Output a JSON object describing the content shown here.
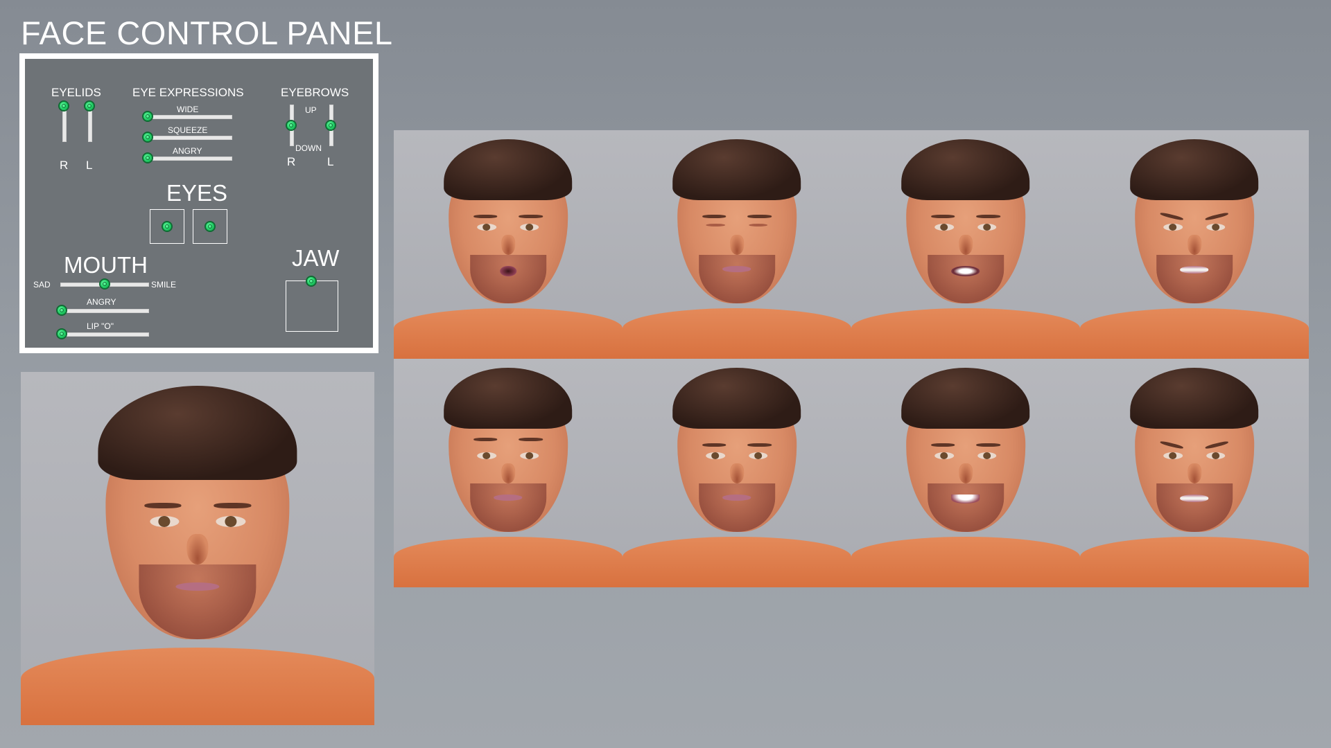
{
  "title": "FACE CONTROL PANEL",
  "panel": {
    "eyelids": {
      "label": "EYELIDS",
      "r": "R",
      "l": "L",
      "r_value": 0.0,
      "l_value": 0.0
    },
    "eye_expressions": {
      "label": "EYE EXPRESSIONS",
      "sliders": [
        {
          "label": "WIDE",
          "value": 0.0
        },
        {
          "label": "SQUEEZE",
          "value": 0.0
        },
        {
          "label": "ANGRY",
          "value": 0.0
        }
      ]
    },
    "eyebrows": {
      "label": "EYEBROWS",
      "up": "UP",
      "down": "DOWN",
      "r": "R",
      "l": "L",
      "r_value": 0.5,
      "l_value": 0.5
    },
    "eyes": {
      "label": "EYES"
    },
    "mouth": {
      "label": "MOUTH",
      "sad": "SAD",
      "smile": "SMILE",
      "sad_smile_value": 0.5,
      "angry": {
        "label": "ANGRY",
        "value": 0.0
      },
      "lip_o": {
        "label": "LIP \"O\"",
        "value": 0.0
      }
    },
    "jaw": {
      "label": "JAW"
    }
  },
  "renders": {
    "main": {
      "alt": "neutral expression"
    },
    "grid": [
      {
        "eyes": "open",
        "brows": "normal",
        "mouth": "o"
      },
      {
        "eyes": "closed",
        "brows": "normal",
        "mouth": "closed"
      },
      {
        "eyes": "open",
        "brows": "normal",
        "mouth": "open"
      },
      {
        "eyes": "open",
        "brows": "angry",
        "mouth": "grit"
      },
      {
        "eyes": "open",
        "brows": "up",
        "mouth": "closed"
      },
      {
        "eyes": "open",
        "brows": "normal",
        "mouth": "closed"
      },
      {
        "eyes": "open",
        "brows": "normal",
        "mouth": "smile"
      },
      {
        "eyes": "open",
        "brows": "angry",
        "mouth": "grit"
      }
    ]
  }
}
